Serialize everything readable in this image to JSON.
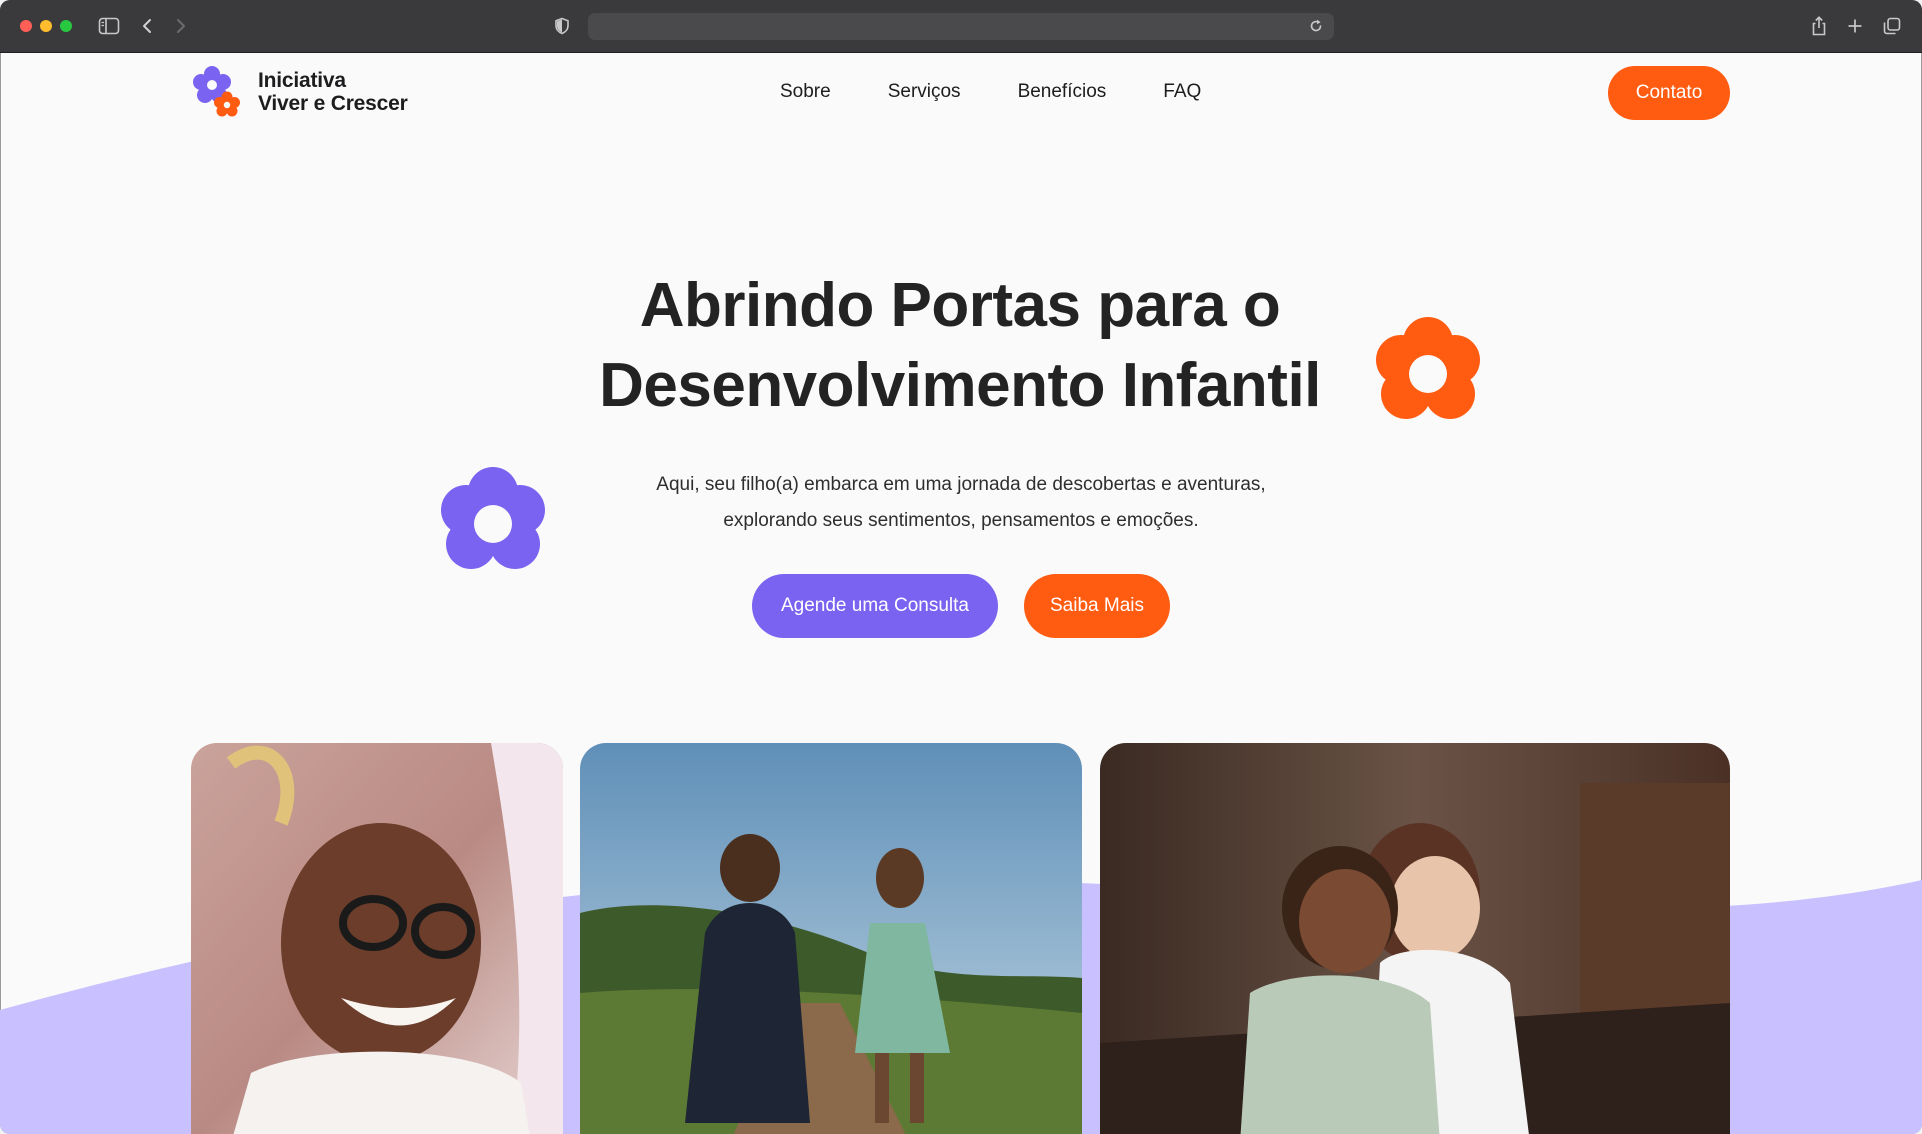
{
  "browser": {
    "address_text": ""
  },
  "brand": {
    "line1": "Iniciativa",
    "line2": "Viver e Crescer"
  },
  "nav": {
    "items": [
      "Sobre",
      "Serviços",
      "Benefícios",
      "FAQ"
    ],
    "contact_label": "Contato"
  },
  "hero": {
    "title": "Abrindo Portas para o Desenvolvimento Infantil",
    "description": "Aqui, seu filho(a) embarca em uma jornada de descobertas e aventuras, explorando seus sentimentos, pensamentos e emoções.",
    "primary_cta": "Agende uma Consulta",
    "secondary_cta": "Saiba Mais"
  },
  "colors": {
    "purple": "#7a63f0",
    "orange": "#ff5b11",
    "wave": "#c8c0ff"
  },
  "icons": [
    "sidebar-icon",
    "back-icon",
    "forward-icon",
    "shield-icon",
    "reload-icon",
    "share-icon",
    "new-tab-icon",
    "tabs-icon",
    "flower-icon"
  ]
}
